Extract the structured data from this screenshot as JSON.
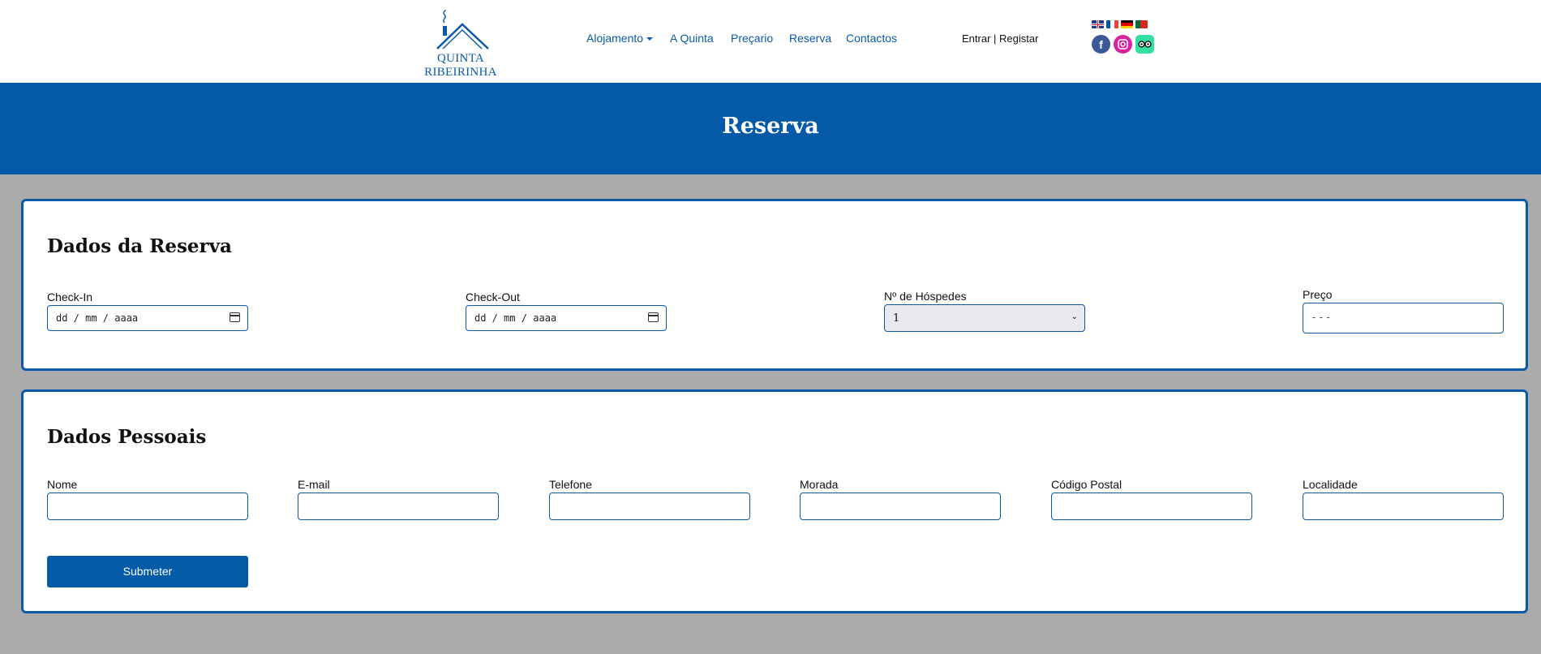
{
  "header": {
    "logo_text": "QUINTA RIBEIRINHA",
    "nav": [
      {
        "label": "Alojamento"
      },
      {
        "label": "A Quinta"
      },
      {
        "label": "Preçario"
      },
      {
        "label": "Reserva"
      },
      {
        "label": "Contactos"
      }
    ],
    "auth": {
      "login": "Entrar",
      "separator": " | ",
      "register": "Registar"
    },
    "languages": [
      "en",
      "fr",
      "de",
      "pt"
    ],
    "socials": [
      "facebook",
      "instagram",
      "tripadvisor"
    ]
  },
  "banner": {
    "title": "Reserva"
  },
  "reservation": {
    "title": "Dados da Reserva",
    "checkin": {
      "label": "Check-In",
      "value": "dd / mm / aaaa"
    },
    "checkout": {
      "label": "Check-Out",
      "value": "dd / mm / aaaa"
    },
    "guests": {
      "label": "Nº de Hóspedes",
      "value": "1"
    },
    "price": {
      "label": "Preço",
      "value": "---"
    }
  },
  "personal": {
    "title": "Dados Pessoais",
    "fields": [
      {
        "label": "Nome"
      },
      {
        "label": "E-mail"
      },
      {
        "label": "Telefone"
      },
      {
        "label": "Morada"
      },
      {
        "label": "Código Postal"
      },
      {
        "label": "Localidade"
      }
    ],
    "submit": "Submeter"
  },
  "colors": {
    "brand": "#045aa7",
    "background": "#ababab"
  }
}
